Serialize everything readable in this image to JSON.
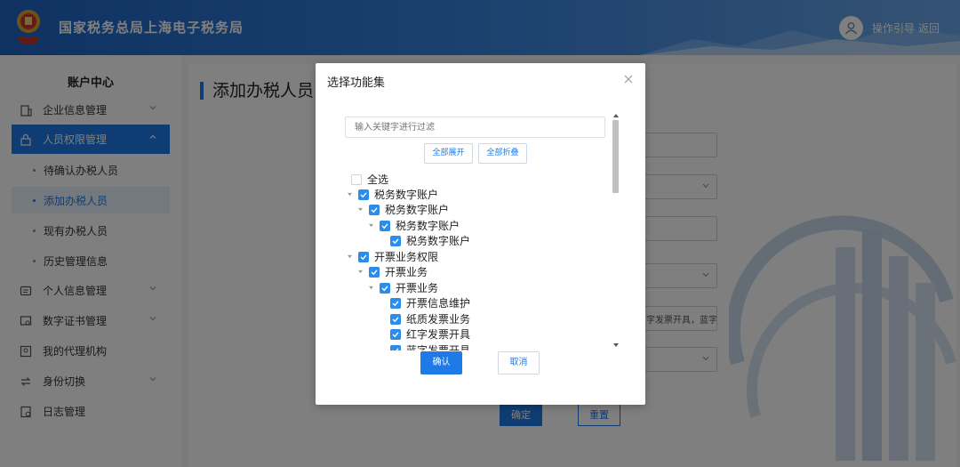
{
  "header": {
    "site_title": "国家税务总局上海电子税务局",
    "guide_link": "操作引导",
    "back_link": "返回",
    "emblem_icon": "tax-emblem-icon",
    "avatar_icon": "user-avatar-icon"
  },
  "sidebar": {
    "title": "账户中心",
    "items": [
      {
        "label": "企业信息管理",
        "icon": "building-icon",
        "expanded": false
      },
      {
        "label": "人员权限管理",
        "icon": "user-lock-icon",
        "expanded": true,
        "active": true
      },
      {
        "label": "待确认办税人员",
        "sub": true
      },
      {
        "label": "添加办税人员",
        "sub": true,
        "active": true
      },
      {
        "label": "现有办税人员",
        "sub": true
      },
      {
        "label": "历史管理信息",
        "sub": true
      },
      {
        "label": "个人信息管理",
        "icon": "id-card-icon",
        "expanded": false
      },
      {
        "label": "数字证书管理",
        "icon": "certificate-icon",
        "expanded": false
      },
      {
        "label": "我的代理机构",
        "icon": "agency-icon"
      },
      {
        "label": "身份切换",
        "icon": "switch-icon",
        "expanded": false
      },
      {
        "label": "日志管理",
        "icon": "log-icon"
      }
    ]
  },
  "main": {
    "heading": "添加办税人员",
    "partial_field_text": "字发票开具，蓝字",
    "confirm_label": "确定",
    "reset_label": "重置"
  },
  "modal": {
    "title": "选择功能集",
    "filter_placeholder": "输入关键字进行过滤",
    "expand_all": "全部展开",
    "collapse_all": "全部折叠",
    "tree": [
      {
        "label": "全选",
        "level": 0,
        "checked": false,
        "caret": false
      },
      {
        "label": "税务数字账户",
        "level": 0,
        "checked": true,
        "caret": true
      },
      {
        "label": "税务数字账户",
        "level": 1,
        "checked": true,
        "caret": true
      },
      {
        "label": "税务数字账户",
        "level": 2,
        "checked": true,
        "caret": true
      },
      {
        "label": "税务数字账户",
        "level": 3,
        "checked": true,
        "caret": false
      },
      {
        "label": "开票业务权限",
        "level": 0,
        "checked": true,
        "caret": true
      },
      {
        "label": "开票业务",
        "level": 1,
        "checked": true,
        "caret": true
      },
      {
        "label": "开票业务",
        "level": 2,
        "checked": true,
        "caret": true
      },
      {
        "label": "开票信息维护",
        "level": 3,
        "checked": true,
        "caret": false
      },
      {
        "label": "纸质发票业务",
        "level": 3,
        "checked": true,
        "caret": false
      },
      {
        "label": "红字发票开具",
        "level": 3,
        "checked": true,
        "caret": false
      },
      {
        "label": "蓝字发票开具",
        "level": 3,
        "checked": true,
        "caret": false
      }
    ],
    "ok_label": "确认",
    "cancel_label": "取消"
  },
  "colors": {
    "primary": "#1e7ae6",
    "checkbox": "#2a8cec",
    "header_start": "#1d64c4",
    "overlay": "rgba(0,0,0,0.5)"
  }
}
